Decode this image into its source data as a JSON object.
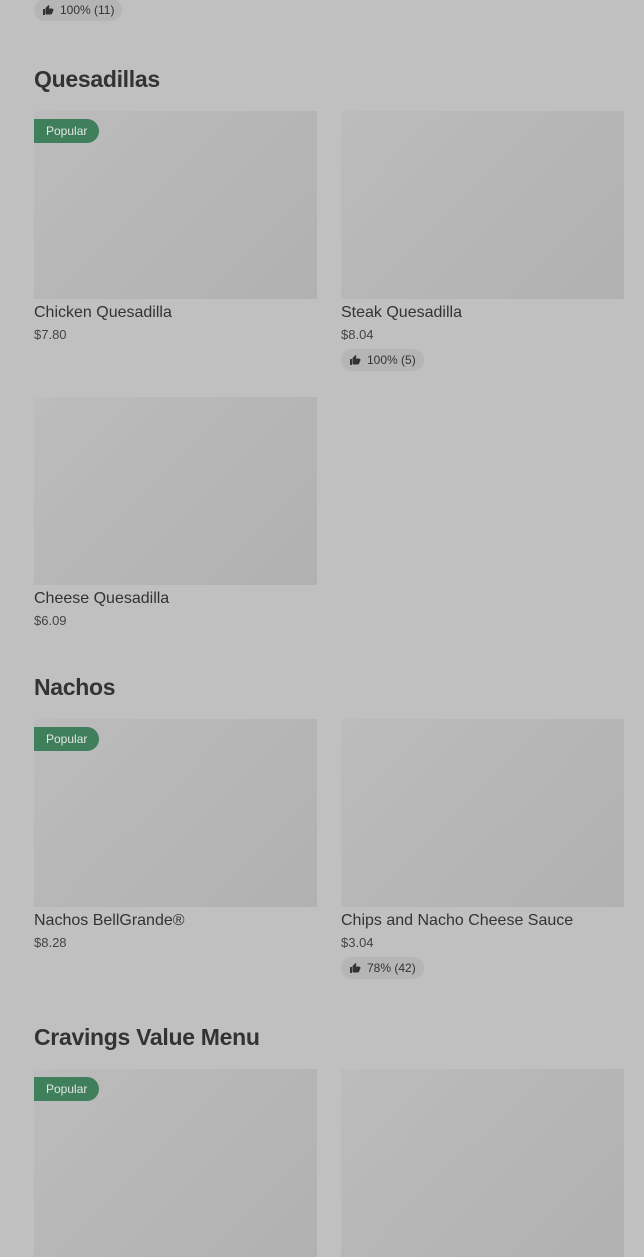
{
  "top_rating": {
    "text": "100% (11)"
  },
  "sections": [
    {
      "title": "Quesadillas",
      "items": [
        {
          "name": "Chicken Quesadilla",
          "price": "$7.80",
          "badge": "Popular"
        },
        {
          "name": "Steak Quesadilla",
          "price": "$8.04",
          "rating": "100% (5)"
        },
        {
          "name": "Cheese Quesadilla",
          "price": "$6.09"
        }
      ]
    },
    {
      "title": "Nachos",
      "items": [
        {
          "name": "Nachos BellGrande®",
          "price": "$8.28",
          "badge": "Popular"
        },
        {
          "name": "Chips and Nacho Cheese Sauce",
          "price": "$3.04",
          "rating": "78% (42)"
        }
      ]
    },
    {
      "title": "Cravings Value Menu",
      "items": [
        {
          "badge": "Popular"
        },
        {}
      ]
    }
  ],
  "icons": {
    "rating": "thumbs-up-icon"
  }
}
